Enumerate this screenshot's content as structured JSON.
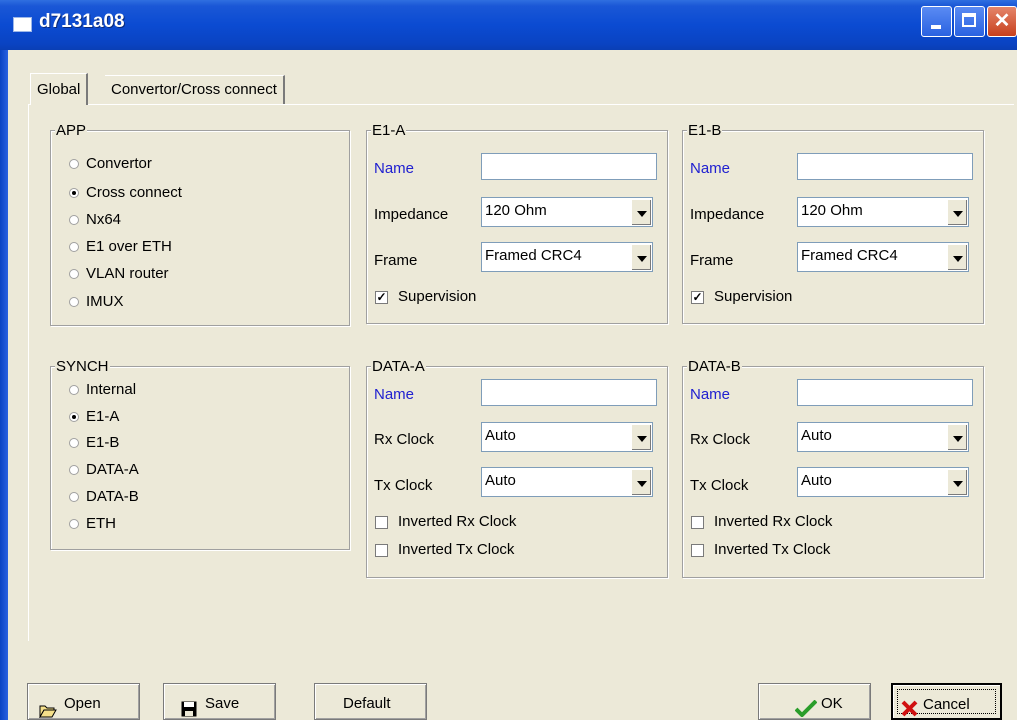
{
  "window": {
    "title": "d7131a08",
    "icons": {
      "app": "window-icon",
      "minimize": "minimize-icon",
      "maximize": "maximize-icon",
      "close": "close-icon"
    }
  },
  "tabs": [
    {
      "label": "Global",
      "active": true
    },
    {
      "label": "Convertor/Cross connect",
      "active": false
    }
  ],
  "app_group": {
    "title": "APP",
    "options": [
      "Convertor",
      "Cross connect",
      "Nx64",
      "E1 over ETH",
      "VLAN router",
      "IMUX"
    ],
    "selected": "Cross connect"
  },
  "synch_group": {
    "title": "SYNCH",
    "options": [
      "Internal",
      "E1-A",
      "E1-B",
      "DATA-A",
      "DATA-B",
      "ETH"
    ],
    "selected": "E1-A"
  },
  "e1_a": {
    "title": "E1-A",
    "name_label": "Name",
    "name_value": "",
    "impedance_label": "Impedance",
    "impedance_value": "120 Ohm",
    "frame_label": "Frame",
    "frame_value": "Framed CRC4",
    "supervision_label": "Supervision",
    "supervision_checked": true
  },
  "e1_b": {
    "title": "E1-B",
    "name_label": "Name",
    "name_value": "",
    "impedance_label": "Impedance",
    "impedance_value": "120 Ohm",
    "frame_label": "Frame",
    "frame_value": "Framed CRC4",
    "supervision_label": "Supervision",
    "supervision_checked": true
  },
  "data_a": {
    "title": "DATA-A",
    "name_label": "Name",
    "name_value": "",
    "rx_label": "Rx Clock",
    "rx_value": "Auto",
    "tx_label": "Tx Clock",
    "tx_value": "Auto",
    "inv_rx_label": "Inverted Rx Clock",
    "inv_rx_checked": false,
    "inv_tx_label": "Inverted Tx Clock",
    "inv_tx_checked": false
  },
  "data_b": {
    "title": "DATA-B",
    "name_label": "Name",
    "name_value": "",
    "rx_label": "Rx Clock",
    "rx_value": "Auto",
    "tx_label": "Tx Clock",
    "tx_value": "Auto",
    "inv_rx_label": "Inverted Rx Clock",
    "inv_rx_checked": false,
    "inv_tx_label": "Inverted Tx Clock",
    "inv_tx_checked": false
  },
  "buttons": {
    "open": {
      "label": "Open",
      "icon": "folder-open-icon"
    },
    "save": {
      "label": "Save",
      "icon": "floppy-disk-icon"
    },
    "default": {
      "label": "Default"
    },
    "ok": {
      "label": "OK",
      "icon": "checkmark-icon"
    },
    "cancel": {
      "label": "Cancel",
      "icon": "red-x-icon"
    }
  },
  "colors": {
    "title_bar": "#0a4bd2",
    "dialog_bg": "#ece9d8",
    "field_label_blue": "#2020d0",
    "close_button": "#c8401d"
  }
}
